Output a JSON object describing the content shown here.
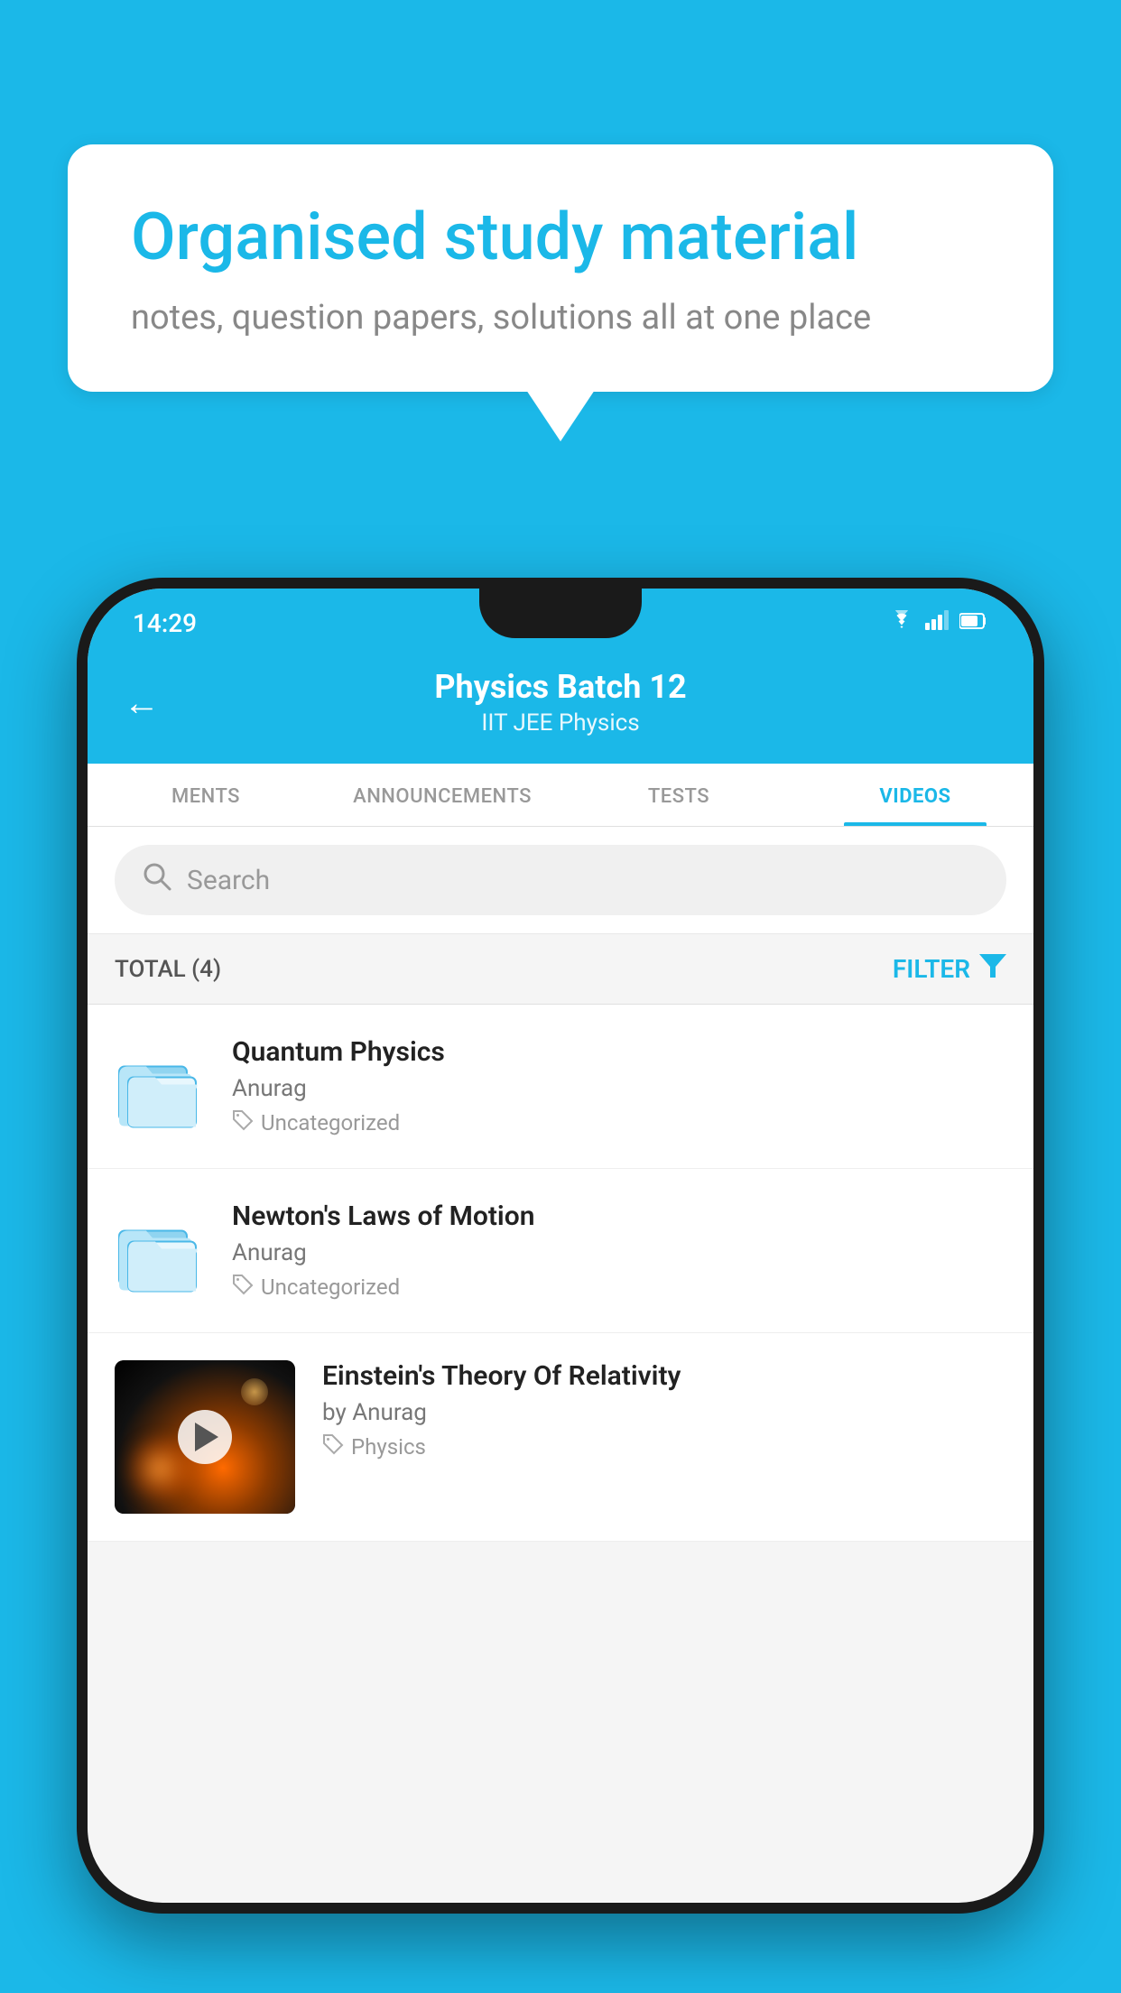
{
  "background_color": "#1bb8e8",
  "speech_bubble": {
    "title": "Organised study material",
    "subtitle": "notes, question papers, solutions all at one place"
  },
  "phone": {
    "status_bar": {
      "time": "14:29",
      "icons": [
        "wifi",
        "signal",
        "battery"
      ]
    },
    "header": {
      "back_label": "←",
      "title": "Physics Batch 12",
      "subtitle": "IIT JEE   Physics"
    },
    "tabs": [
      {
        "label": "MENTS",
        "active": false
      },
      {
        "label": "ANNOUNCEMENTS",
        "active": false
      },
      {
        "label": "TESTS",
        "active": false
      },
      {
        "label": "VIDEOS",
        "active": true
      }
    ],
    "search": {
      "placeholder": "Search"
    },
    "filter_bar": {
      "total_label": "TOTAL (4)",
      "filter_label": "FILTER"
    },
    "videos": [
      {
        "title": "Quantum Physics",
        "author": "Anurag",
        "tag": "Uncategorized",
        "has_thumbnail": false
      },
      {
        "title": "Newton's Laws of Motion",
        "author": "Anurag",
        "tag": "Uncategorized",
        "has_thumbnail": false
      },
      {
        "title": "Einstein's Theory Of Relativity",
        "author": "by Anurag",
        "tag": "Physics",
        "has_thumbnail": true
      }
    ]
  }
}
